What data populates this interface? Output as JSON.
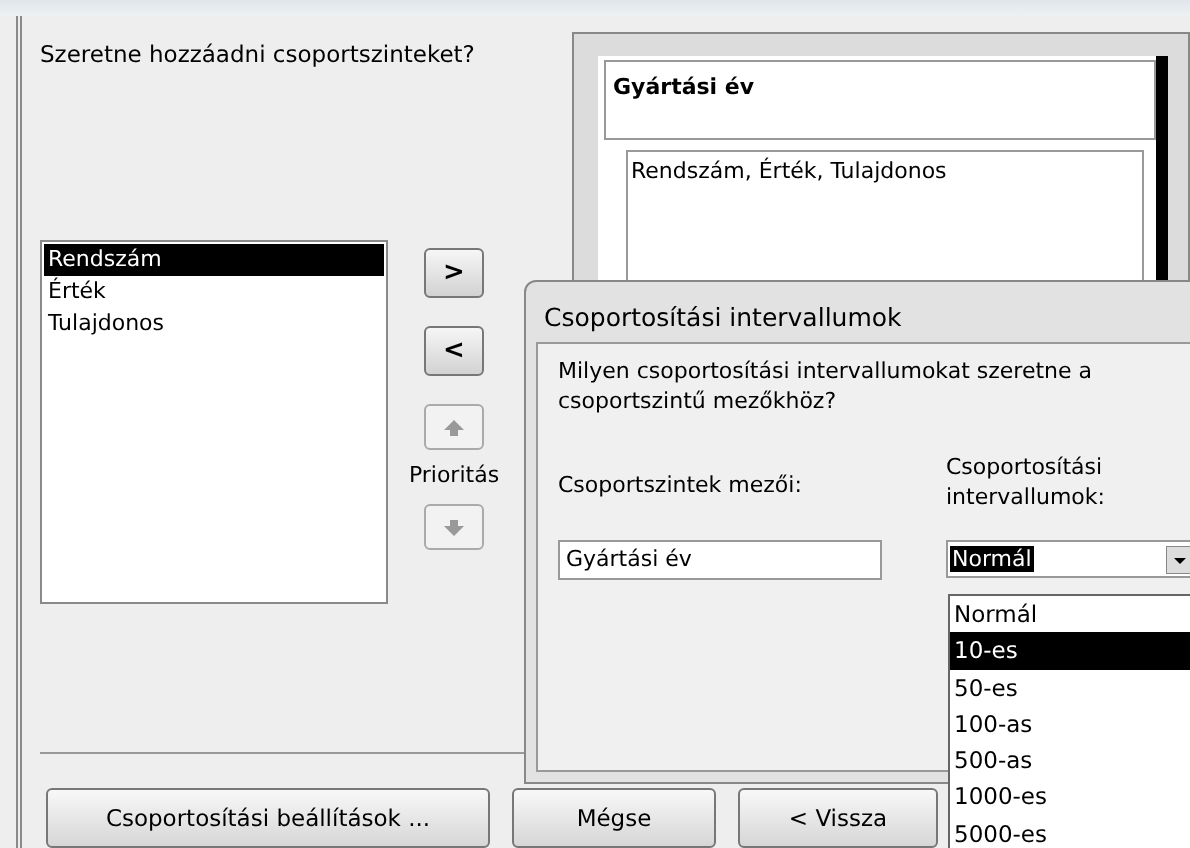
{
  "question": "Szeretne hozzáadni csoportszinteket?",
  "fields": [
    {
      "label": "Rendszám",
      "selected": true
    },
    {
      "label": "Érték",
      "selected": false
    },
    {
      "label": "Tulajdonos",
      "selected": false
    }
  ],
  "move_buttons": [
    ">",
    "<"
  ],
  "priority": {
    "label": "Prioritás"
  },
  "preview": {
    "group_header": "Gyártási év",
    "detail_fields": "Rendszám, Érték, Tulajdonos"
  },
  "dialog": {
    "title": "Csoportosítási intervallumok",
    "prompt": "Milyen csoportosítási intervallumokat szeretne a csoportszintű mezőkhöz?",
    "field_column_label": "Csoportszintek mezői:",
    "interval_column_label": "Csoportosítási intervallumok:",
    "field_value": "Gyártási év",
    "interval_value": "Normál",
    "interval_options": [
      {
        "label": "Normál",
        "selected": false
      },
      {
        "label": "10-es",
        "selected": true
      },
      {
        "label": "50-es",
        "selected": false
      },
      {
        "label": "100-as",
        "selected": false
      },
      {
        "label": "500-as",
        "selected": false
      },
      {
        "label": "1000-es",
        "selected": false
      },
      {
        "label": "5000-es",
        "selected": false
      }
    ]
  },
  "buttons": [
    "Csoportosítási beállítások ...",
    "Mégse",
    "< Vissza"
  ]
}
